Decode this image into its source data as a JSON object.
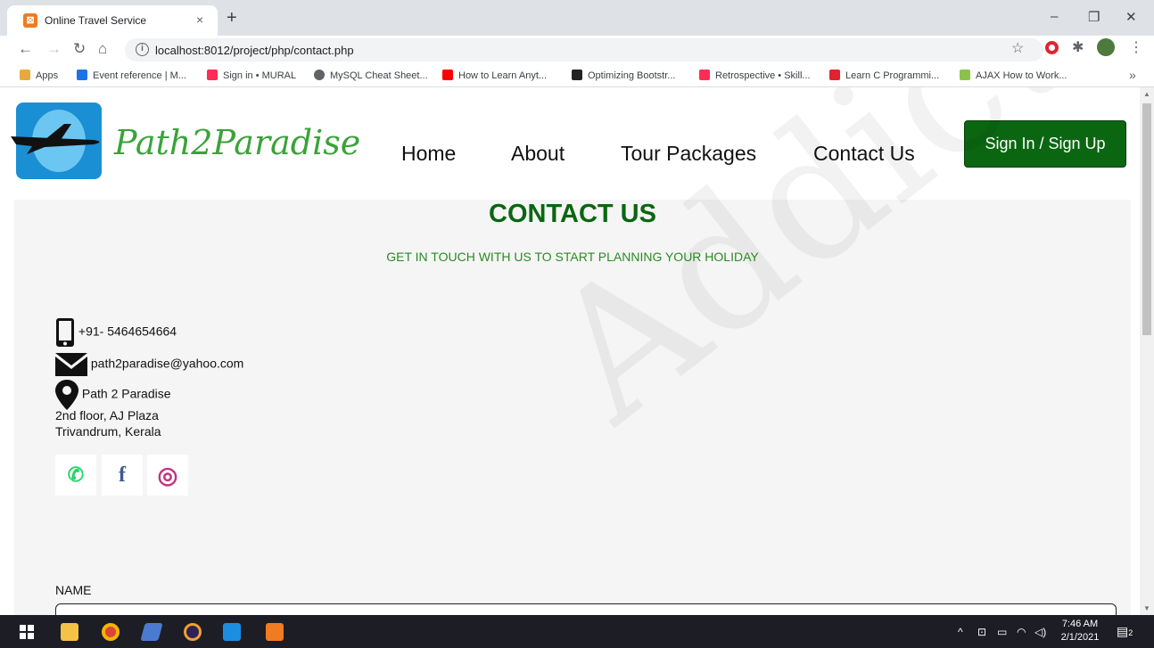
{
  "browser": {
    "tab_title": "Online Travel Service",
    "tab_close": "×",
    "new_tab": "+",
    "url": "localhost:8012/project/php/contact.php",
    "window_controls": {
      "minimize": "–",
      "restore": "❐",
      "close": "✕"
    },
    "bookmarks": [
      {
        "label": "Apps",
        "color": "#e8a93a"
      },
      {
        "label": "Event reference | M...",
        "color": "#1a73e8"
      },
      {
        "label": "Sign in • MURAL",
        "color": "#ff2d55"
      },
      {
        "label": "MySQL Cheat Sheet...",
        "color": "#5f6368"
      },
      {
        "label": "How to Learn Anyt...",
        "color": "#ff0000"
      },
      {
        "label": "Optimizing Bootstr...",
        "color": "#222222"
      },
      {
        "label": "Retrospective • Skill...",
        "color": "#ff2d55"
      },
      {
        "label": "Learn C Programmi...",
        "color": "#e0242f"
      },
      {
        "label": "AJAX How to Work...",
        "color": "#8bc34a"
      }
    ],
    "bookmark_more": "»"
  },
  "site": {
    "logo_text": "Path2Paradise",
    "nav": [
      "Home",
      "About",
      "Tour Packages",
      "Contact Us"
    ],
    "signin_label": "Sign In / Sign Up"
  },
  "contact": {
    "title": "CONTACT US",
    "subtitle": "GET IN TOUCH WITH US TO START PLANNING YOUR HOLIDAY",
    "phone": "+91- 5464654664",
    "email": "path2paradise@yahoo.com",
    "address_name": "Path 2 Paradise",
    "address_line1": "2nd floor, AJ Plaza",
    "address_line2": "Trivandrum, Kerala",
    "social": [
      {
        "name": "whatsapp",
        "glyph": "✆",
        "color": "#25d366"
      },
      {
        "name": "facebook",
        "glyph": "f",
        "color": "#3b5998"
      },
      {
        "name": "instagram",
        "glyph": "◎",
        "color": "#c13584"
      }
    ],
    "name_label": "NAME"
  },
  "watermark": "Addict",
  "taskbar": {
    "time": "7:46 AM",
    "date": "2/1/2021",
    "notification_count": "2"
  }
}
